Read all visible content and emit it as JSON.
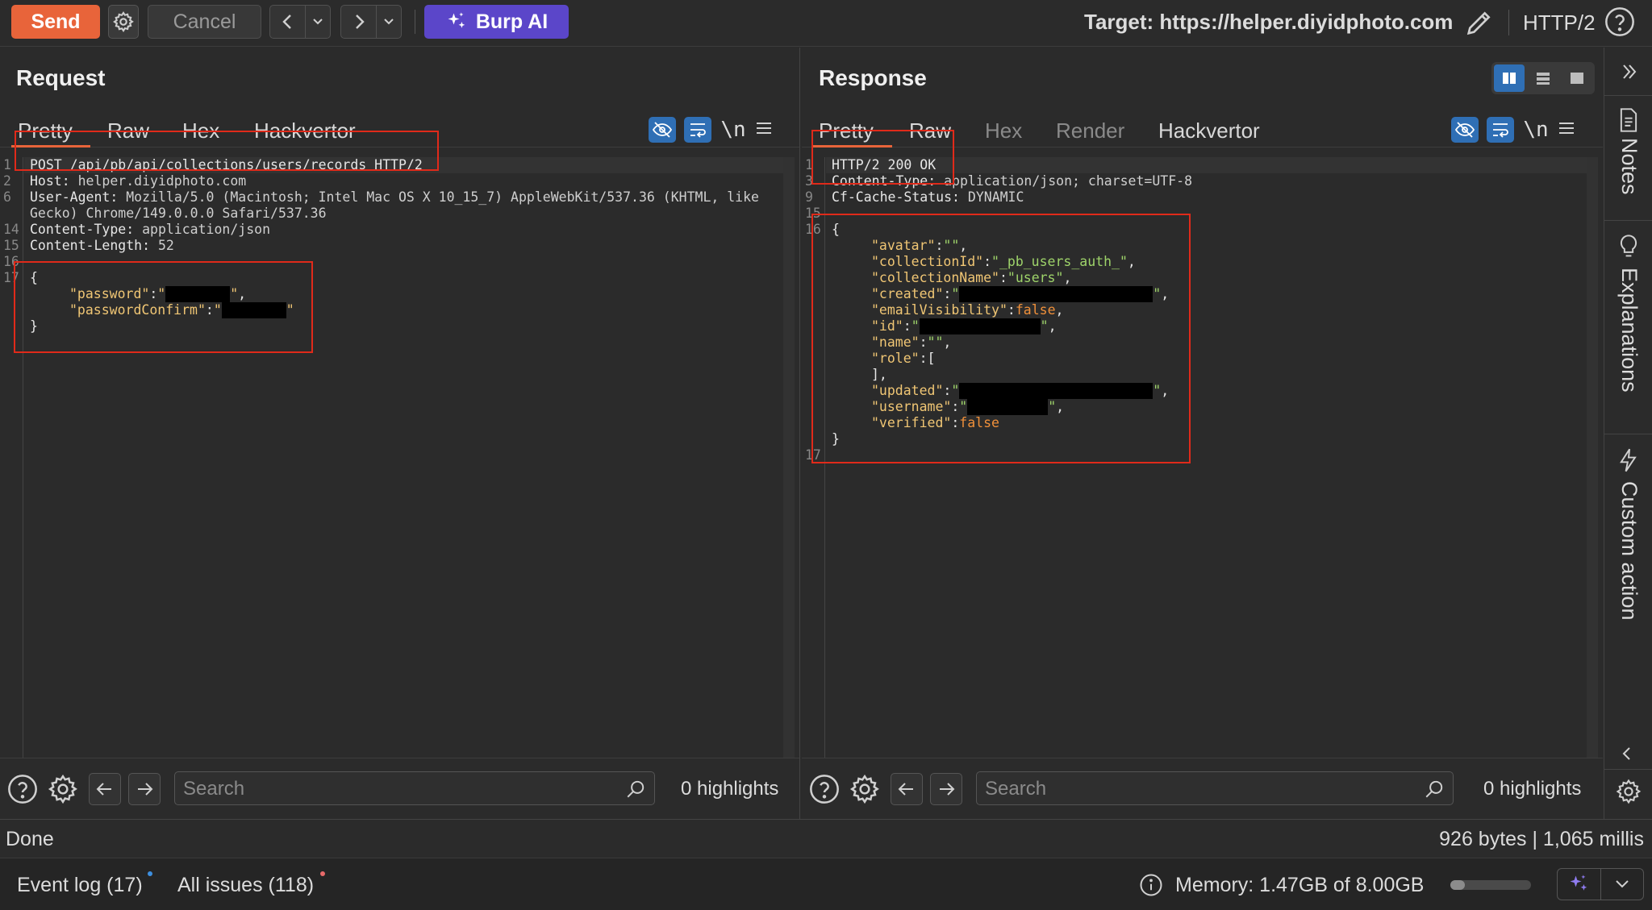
{
  "toolbar": {
    "send_label": "Send",
    "cancel_label": "Cancel",
    "burp_ai_label": "Burp AI",
    "target_text": "Target: https://helper.diyidphoto.com",
    "http_version": "HTTP/2"
  },
  "request": {
    "title": "Request",
    "tabs": [
      "Pretty",
      "Raw",
      "Hex",
      "Hackvertor"
    ],
    "active_tab": "Pretty",
    "lines": [
      {
        "ln": "1",
        "name": "POST /api/pb/api/collections/users/records HTTP/2",
        "value": ""
      },
      {
        "ln": "2",
        "name": "Host:",
        "value": " helper.diyidphoto.com"
      },
      {
        "ln": "6",
        "name": "User-Agent:",
        "value": " Mozilla/5.0 (Macintosh; Intel Mac OS X 10_15_7) AppleWebKit/537.36 (KHTML, like"
      },
      {
        "ln": "",
        "name": "",
        "value": "Gecko) Chrome/149.0.0.0 Safari/537.36"
      },
      {
        "ln": "14",
        "name": "Content-Type:",
        "value": " application/json"
      },
      {
        "ln": "15",
        "name": "Content-Length:",
        "value": " 52"
      },
      {
        "ln": "16",
        "name": "",
        "value": ""
      },
      {
        "ln": "17",
        "name": "{",
        "value": ""
      }
    ],
    "body": {
      "password_key": "\"password\"",
      "password_confirm_key": "\"passwordConfirm\"",
      "close_brace": "}"
    },
    "search_placeholder": "Search",
    "highlights": "0 highlights"
  },
  "response": {
    "title": "Response",
    "tabs": [
      "Pretty",
      "Raw",
      "Hex",
      "Render",
      "Hackvertor"
    ],
    "active_tab": "Pretty",
    "lines": [
      {
        "ln": "1",
        "name": "HTTP/2 200 OK",
        "value": ""
      },
      {
        "ln": "3",
        "name": "Content-Type:",
        "value": " application/json; charset=UTF-8"
      },
      {
        "ln": "9",
        "name": "Cf-Cache-Status:",
        "value": " DYNAMIC"
      },
      {
        "ln": "15",
        "name": "",
        "value": ""
      },
      {
        "ln": "16",
        "name": "{",
        "value": ""
      }
    ],
    "json": {
      "avatar_key": "\"avatar\"",
      "avatar_val": "\"\"",
      "collectionId_key": "\"collectionId\"",
      "collectionId_val": "\"_pb_users_auth_\"",
      "collectionName_key": "\"collectionName\"",
      "collectionName_val": "\"users\"",
      "created_key": "\"created\"",
      "emailVisibility_key": "\"emailVisibility\"",
      "emailVisibility_val": "false",
      "id_key": "\"id\"",
      "name_key": "\"name\"",
      "name_val": "\"\"",
      "role_key": "\"role\"",
      "updated_key": "\"updated\"",
      "username_key": "\"username\"",
      "verified_key": "\"verified\"",
      "verified_val": "false",
      "close_brace": "}",
      "last_ln": "17"
    },
    "search_placeholder": "Search",
    "highlights": "0 highlights"
  },
  "sidebar": {
    "items": [
      "Notes",
      "Explanations",
      "Custom action"
    ]
  },
  "status": {
    "left": "Done",
    "right": "926 bytes | 1,065 millis"
  },
  "footer": {
    "event_log": "Event log (17)",
    "all_issues": "All issues (118)",
    "memory": "Memory: 1.47GB of 8.00GB",
    "memory_fraction": 0.18
  },
  "colors": {
    "accent": "#e8643a",
    "burp_ai": "#5b46c9",
    "active_icon": "#2f6fb5",
    "redaction_box": "#e02a1a"
  }
}
